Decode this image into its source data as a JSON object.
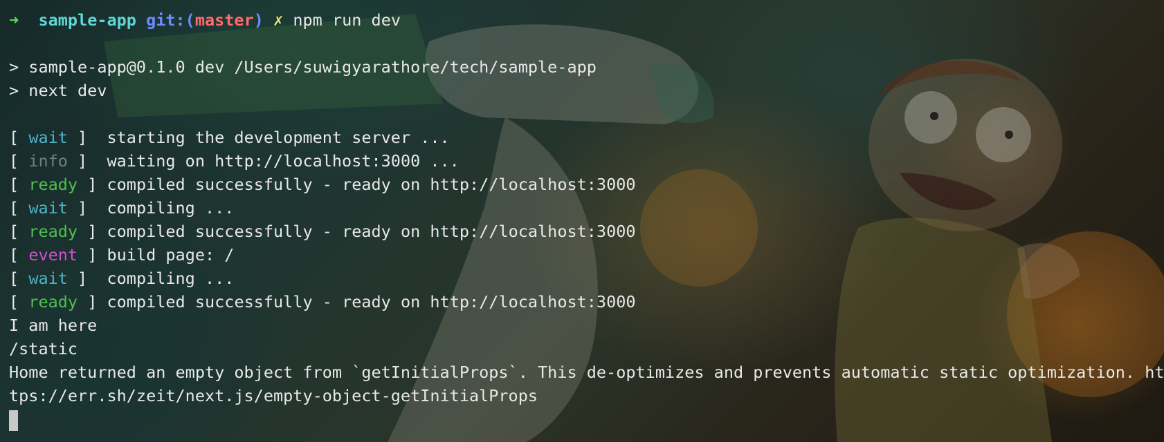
{
  "prompt": {
    "arrow": "➜",
    "directory": "sample-app",
    "git_prefix": "git:(",
    "branch": "master",
    "git_suffix": ")",
    "dirty_marker": "✗",
    "command": "npm run dev"
  },
  "script_header": [
    "> sample-app@0.1.0 dev /Users/suwigyarathore/tech/sample-app",
    "> next dev"
  ],
  "log_lines": [
    {
      "tag": "wait",
      "pre": " ",
      "post": " ]  ",
      "message": "starting the development server ..."
    },
    {
      "tag": "info",
      "pre": " ",
      "post": " ]  ",
      "message": "waiting on http://localhost:3000 ..."
    },
    {
      "tag": "ready",
      "pre": " ",
      "post": " ] ",
      "message": "compiled successfully - ready on http://localhost:3000"
    },
    {
      "tag": "wait",
      "pre": " ",
      "post": " ]  ",
      "message": "compiling ..."
    },
    {
      "tag": "ready",
      "pre": " ",
      "post": " ] ",
      "message": "compiled successfully - ready on http://localhost:3000"
    },
    {
      "tag": "event",
      "pre": " ",
      "post": " ] ",
      "message": "build page: /"
    },
    {
      "tag": "wait",
      "pre": " ",
      "post": " ]  ",
      "message": "compiling ..."
    },
    {
      "tag": "ready",
      "pre": " ",
      "post": " ] ",
      "message": "compiled successfully - ready on http://localhost:3000"
    }
  ],
  "output_lines": [
    "I am here",
    "/static",
    "Home returned an empty object from `getInitialProps`. This de-optimizes and prevents automatic static optimization. ht",
    "tps://err.sh/zeit/next.js/empty-object-getInitialProps"
  ],
  "colors": {
    "wait": "#4fb3c8",
    "info": "#6e8080",
    "ready": "#4fc04f",
    "event": "#d34fd3",
    "prompt_arrow": "#5fd75f",
    "prompt_dir": "#5fd7d7",
    "prompt_git": "#6f8cff",
    "prompt_branch": "#ff6b6b",
    "prompt_dirty": "#f5e56b"
  }
}
